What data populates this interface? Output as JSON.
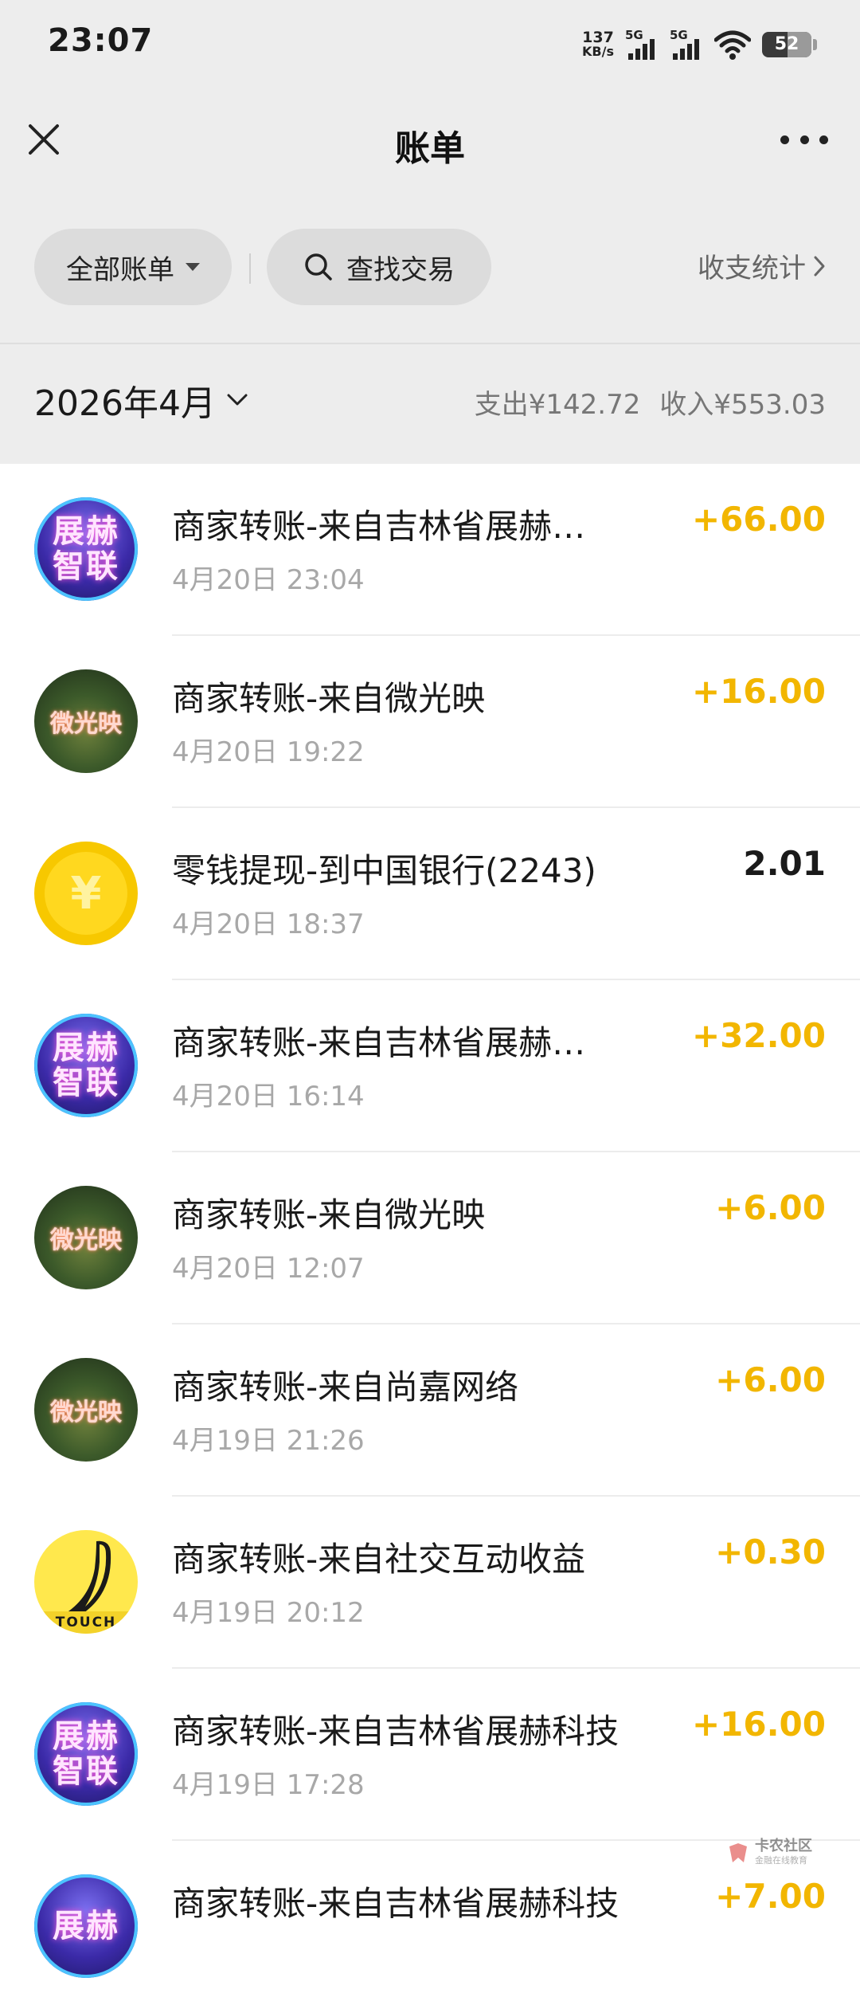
{
  "status_bar": {
    "time": "23:07",
    "net_speed_value": "137",
    "net_speed_unit": "KB/s",
    "signal_1_label": "5G",
    "signal_2_label": "5G",
    "battery": "52"
  },
  "nav": {
    "title": "账单"
  },
  "filters": {
    "all_bills": "全部账单",
    "search": "查找交易",
    "stats": "收支统计"
  },
  "month": {
    "label": "2026年4月",
    "expense": "支出¥142.72",
    "income": "收入¥553.03"
  },
  "transactions": [
    {
      "title": "商家转账-来自吉林省展赫…",
      "time": "4月20日 23:04",
      "amount": "+66.00",
      "avatar_text": "展赫智联"
    },
    {
      "title": "商家转账-来自微光映",
      "time": "4月20日 19:22",
      "amount": "+16.00",
      "avatar_text": "微光映"
    },
    {
      "title": "零钱提现-到中国银行(2243)",
      "time": "4月20日 18:37",
      "amount": "2.01",
      "avatar_text": "¥"
    },
    {
      "title": "商家转账-来自吉林省展赫…",
      "time": "4月20日 16:14",
      "amount": "+32.00",
      "avatar_text": "展赫智联"
    },
    {
      "title": "商家转账-来自微光映",
      "time": "4月20日 12:07",
      "amount": "+6.00",
      "avatar_text": "微光映"
    },
    {
      "title": "商家转账-来自尚嘉网络",
      "time": "4月19日 21:26",
      "amount": "+6.00",
      "avatar_text": "微光映"
    },
    {
      "title": "商家转账-来自社交互动收益",
      "time": "4月19日 20:12",
      "amount": "+0.30",
      "avatar_text": "TOUCH"
    },
    {
      "title": "商家转账-来自吉林省展赫科技",
      "time": "4月19日 17:28",
      "amount": "+16.00",
      "avatar_text": "展赫智联"
    },
    {
      "title": "商家转账-来自吉林省展赫科技",
      "time": "",
      "amount": "+7.00",
      "avatar_text": "展赫"
    }
  ],
  "watermark": {
    "name": "卡农社区",
    "tagline": "金融在线教育"
  },
  "colors": {
    "income": "#f2b600",
    "background_gray": "#ededed"
  }
}
